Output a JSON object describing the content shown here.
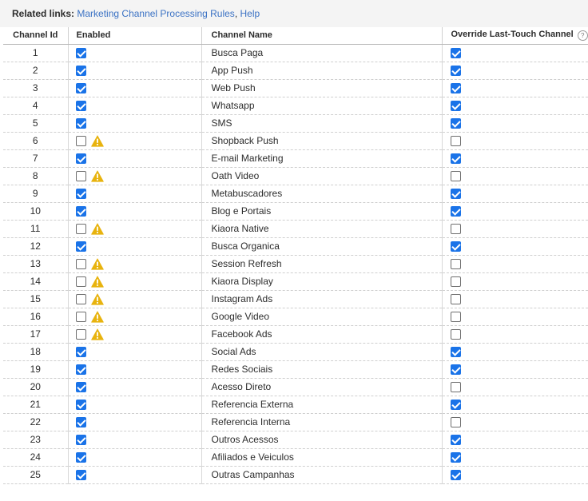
{
  "related": {
    "label": "Related links:",
    "links": [
      "Marketing Channel Processing Rules",
      "Help"
    ],
    "separator": ","
  },
  "columns": {
    "id": "Channel Id",
    "enabled": "Enabled",
    "name": "Channel Name",
    "override": "Override Last-Touch Channel",
    "override_help_icon": "question-circle-icon"
  },
  "warning_icon": "warning-triangle-icon",
  "colors": {
    "checkbox_checked": "#1a73e8",
    "warning": "#e8b30e",
    "link": "#3b72c4"
  },
  "rows": [
    {
      "id": "1",
      "enabled": true,
      "warning": false,
      "name": "Busca Paga",
      "override": true
    },
    {
      "id": "2",
      "enabled": true,
      "warning": false,
      "name": "App Push",
      "override": true
    },
    {
      "id": "3",
      "enabled": true,
      "warning": false,
      "name": "Web Push",
      "override": true
    },
    {
      "id": "4",
      "enabled": true,
      "warning": false,
      "name": "Whatsapp",
      "override": true
    },
    {
      "id": "5",
      "enabled": true,
      "warning": false,
      "name": "SMS",
      "override": true
    },
    {
      "id": "6",
      "enabled": false,
      "warning": true,
      "name": "Shopback Push",
      "override": false
    },
    {
      "id": "7",
      "enabled": true,
      "warning": false,
      "name": "E-mail Marketing",
      "override": true
    },
    {
      "id": "8",
      "enabled": false,
      "warning": true,
      "name": "Oath Video",
      "override": false
    },
    {
      "id": "9",
      "enabled": true,
      "warning": false,
      "name": "Metabuscadores",
      "override": true
    },
    {
      "id": "10",
      "enabled": true,
      "warning": false,
      "name": "Blog e Portais",
      "override": true
    },
    {
      "id": "11",
      "enabled": false,
      "warning": true,
      "name": "Kiaora Native",
      "override": false
    },
    {
      "id": "12",
      "enabled": true,
      "warning": false,
      "name": "Busca Organica",
      "override": true
    },
    {
      "id": "13",
      "enabled": false,
      "warning": true,
      "name": "Session Refresh",
      "override": false
    },
    {
      "id": "14",
      "enabled": false,
      "warning": true,
      "name": "Kiaora Display",
      "override": false
    },
    {
      "id": "15",
      "enabled": false,
      "warning": true,
      "name": "Instagram Ads",
      "override": false
    },
    {
      "id": "16",
      "enabled": false,
      "warning": true,
      "name": "Google Video",
      "override": false
    },
    {
      "id": "17",
      "enabled": false,
      "warning": true,
      "name": "Facebook Ads",
      "override": false
    },
    {
      "id": "18",
      "enabled": true,
      "warning": false,
      "name": "Social Ads",
      "override": true
    },
    {
      "id": "19",
      "enabled": true,
      "warning": false,
      "name": "Redes Sociais",
      "override": true
    },
    {
      "id": "20",
      "enabled": true,
      "warning": false,
      "name": "Acesso Direto",
      "override": false
    },
    {
      "id": "21",
      "enabled": true,
      "warning": false,
      "name": "Referencia Externa",
      "override": true
    },
    {
      "id": "22",
      "enabled": true,
      "warning": false,
      "name": "Referencia Interna",
      "override": false
    },
    {
      "id": "23",
      "enabled": true,
      "warning": false,
      "name": "Outros Acessos",
      "override": true
    },
    {
      "id": "24",
      "enabled": true,
      "warning": false,
      "name": "Afiliados e Veiculos",
      "override": true
    },
    {
      "id": "25",
      "enabled": true,
      "warning": false,
      "name": "Outras Campanhas",
      "override": true
    }
  ]
}
